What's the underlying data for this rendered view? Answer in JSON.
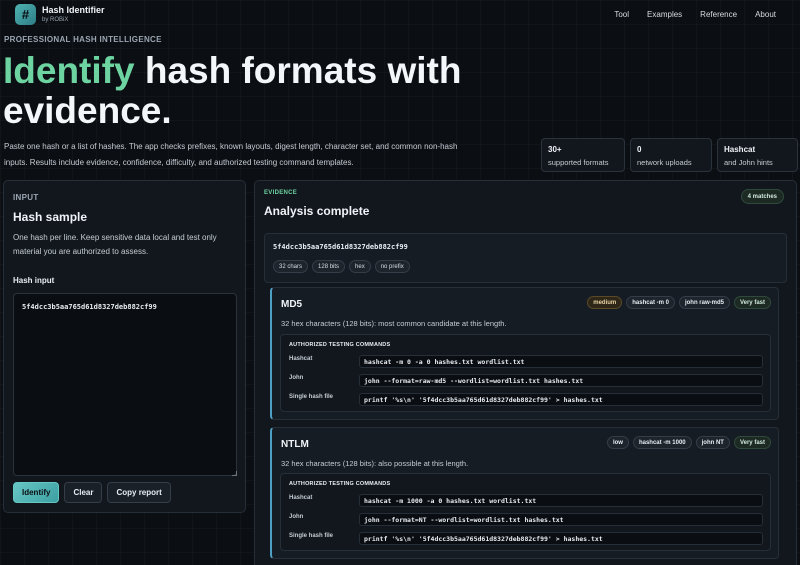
{
  "header": {
    "logo_glyph": "#",
    "title": "Hash Identifier",
    "subtitle": "by ROBiX",
    "nav": [
      "Tool",
      "Examples",
      "Reference",
      "About"
    ]
  },
  "hero": {
    "eyebrow": "PROFESSIONAL HASH INTELLIGENCE",
    "title_accent": "Identify",
    "title_rest": " hash formats with evidence.",
    "description": "Paste one hash or a list of hashes. The app checks prefixes, known layouts, digest length, character set, and common non-hash inputs. Results include evidence, confidence, difficulty, and authorized testing command templates.",
    "stats": [
      {
        "value": "30+",
        "label": "supported formats"
      },
      {
        "value": "0",
        "label": "network uploads"
      },
      {
        "value": "Hashcat",
        "label": "and John hints"
      }
    ]
  },
  "input_panel": {
    "section_label": "INPUT",
    "title": "Hash sample",
    "help": "One hash per line. Keep sensitive data local and test only material you are authorized to assess.",
    "field_label": "Hash input",
    "value": "5f4dcc3b5aa765d61d8327deb882cf99",
    "buttons": {
      "identify": "Identify",
      "clear": "Clear",
      "copy": "Copy report"
    }
  },
  "evidence": {
    "section_label": "EVIDENCE",
    "title": "Analysis complete",
    "match_count": "4 matches",
    "hash": "5f4dcc3b5aa765d61d8327deb882cf99",
    "chips": [
      "32 chars",
      "128 bits",
      "hex",
      "no prefix"
    ],
    "commands_title": "AUTHORIZED TESTING COMMANDS",
    "command_labels": {
      "hashcat": "Hashcat",
      "john": "John",
      "single": "Single hash file"
    },
    "results": [
      {
        "name": "MD5",
        "description": "32 hex characters (128 bits): most common candidate at this length.",
        "tags": [
          "medium",
          "hashcat -m 0",
          "john raw-md5",
          "Very fast"
        ],
        "hashcat": "hashcat -m 0 -a 0 hashes.txt wordlist.txt",
        "john": "john --format=raw-md5 --wordlist=wordlist.txt hashes.txt",
        "single": "printf '%s\\n' '5f4dcc3b5aa765d61d8327deb882cf99' > hashes.txt"
      },
      {
        "name": "NTLM",
        "description": "32 hex characters (128 bits): also possible at this length.",
        "tags": [
          "low",
          "hashcat -m 1000",
          "john NT",
          "Very fast"
        ],
        "hashcat": "hashcat -m 1000 -a 0 hashes.txt wordlist.txt",
        "john": "john --format=NT --wordlist=wordlist.txt hashes.txt",
        "single": "printf '%s\\n' '5f4dcc3b5aa765d61d8327deb882cf99' > hashes.txt"
      }
    ]
  },
  "colors": {
    "accent_green": "#6dd3a1",
    "accent_teal": "#66c7c4",
    "card_border_accent": "#4f9fc4",
    "background": "#0b0e12"
  }
}
